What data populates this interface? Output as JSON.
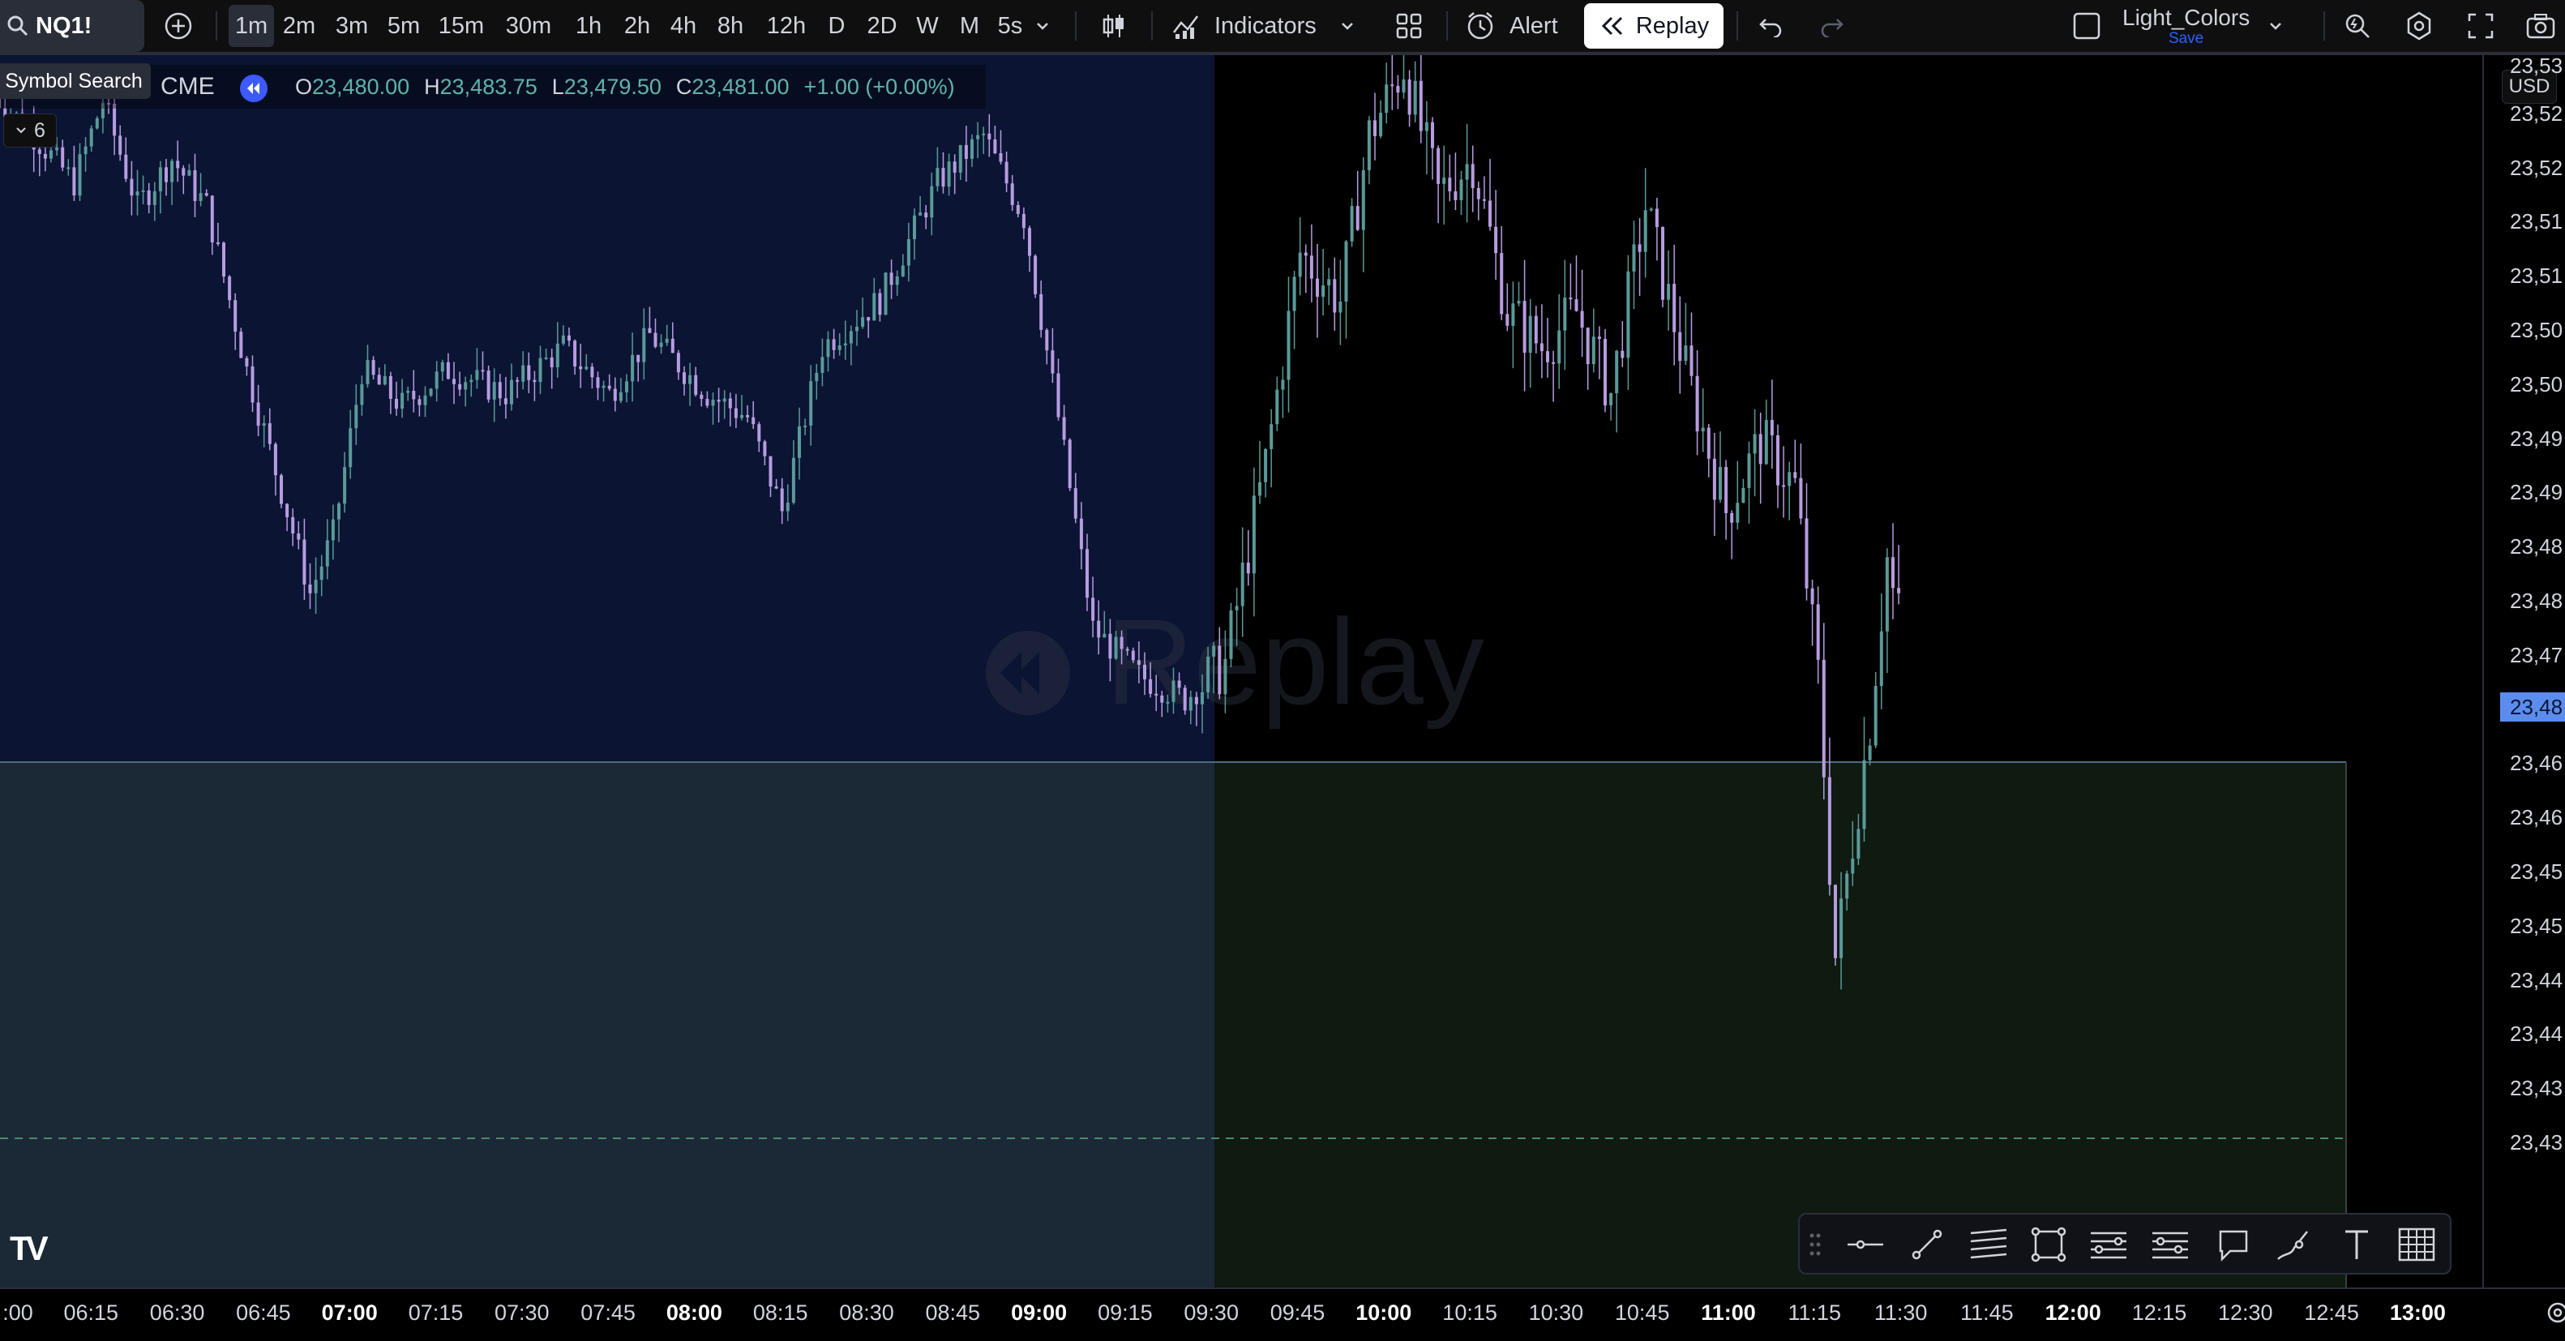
{
  "toolbar": {
    "symbol": "NQ1!",
    "timeframes": [
      "1m",
      "2m",
      "3m",
      "5m",
      "15m",
      "30m",
      "1h",
      "2h",
      "4h",
      "8h",
      "12h",
      "D",
      "2D",
      "W",
      "M",
      "5s"
    ],
    "active_timeframe": "1m",
    "indicators_label": "Indicators",
    "alert_label": "Alert",
    "replay_label": "Replay",
    "layout_name": "Light_Colors",
    "layout_save_label": "Save",
    "icons": [
      "search-icon",
      "add-symbol-icon",
      "chevron-down-icon",
      "candle-style-icon",
      "indicators-icon",
      "templates-grid-icon",
      "alert-clock-icon",
      "replay-rewind-icon",
      "undo-icon",
      "redo-icon",
      "layout-checkbox-icon",
      "quick-search-icon",
      "settings-gear-icon",
      "fullscreen-icon",
      "snapshot-camera-icon"
    ]
  },
  "tooltip": {
    "text": "Symbol Search"
  },
  "legend": {
    "exchange": "CME",
    "open_label": "O",
    "open": "23,480.00",
    "high_label": "H",
    "high": "23,483.75",
    "low_label": "L",
    "low": "23,479.50",
    "close_label": "C",
    "close": "23,481.00",
    "change": "+1.00 (+0.00%)",
    "collapse_count": "6"
  },
  "watermark": {
    "text": "Replay"
  },
  "price_axis": {
    "currency": "USD",
    "labels": [
      "23,53",
      "23,52",
      "23,52",
      "23,51",
      "23,51",
      "23,50",
      "23,50",
      "23,49",
      "23,49",
      "23,48",
      "23,48",
      "23,47",
      "23,47",
      "23,46",
      "23,46",
      "23,45",
      "23,45",
      "23,44",
      "23,44",
      "23,43",
      "23,43"
    ],
    "current_price": "23,48"
  },
  "time_axis": {
    "labels": [
      {
        "t": ":00",
        "bold": false
      },
      {
        "t": "06:15",
        "bold": false
      },
      {
        "t": "06:30",
        "bold": false
      },
      {
        "t": "06:45",
        "bold": false
      },
      {
        "t": "07:00",
        "bold": true
      },
      {
        "t": "07:15",
        "bold": false
      },
      {
        "t": "07:30",
        "bold": false
      },
      {
        "t": "07:45",
        "bold": false
      },
      {
        "t": "08:00",
        "bold": true
      },
      {
        "t": "08:15",
        "bold": false
      },
      {
        "t": "08:30",
        "bold": false
      },
      {
        "t": "08:45",
        "bold": false
      },
      {
        "t": "09:00",
        "bold": true
      },
      {
        "t": "09:15",
        "bold": false
      },
      {
        "t": "09:30",
        "bold": false
      },
      {
        "t": "09:45",
        "bold": false
      },
      {
        "t": "10:00",
        "bold": true
      },
      {
        "t": "10:15",
        "bold": false
      },
      {
        "t": "10:30",
        "bold": false
      },
      {
        "t": "10:45",
        "bold": false
      },
      {
        "t": "11:00",
        "bold": true
      },
      {
        "t": "11:15",
        "bold": false
      },
      {
        "t": "11:30",
        "bold": false
      },
      {
        "t": "11:45",
        "bold": false
      },
      {
        "t": "12:00",
        "bold": true
      },
      {
        "t": "12:15",
        "bold": false
      },
      {
        "t": "12:30",
        "bold": false
      },
      {
        "t": "12:45",
        "bold": false
      },
      {
        "t": "13:00",
        "bold": true
      }
    ]
  },
  "drawing_tools": [
    "drag-handle-icon",
    "horizontal-ray-icon",
    "trend-line-icon",
    "parallel-channel-icon",
    "rectangle-icon",
    "fib-retracement-icon",
    "fib-levels-icon",
    "callout-icon",
    "brush-icon",
    "text-tool-icon",
    "grid-table-icon"
  ],
  "brand": {
    "logo_text": "TV"
  },
  "colors": {
    "background": "#000000",
    "premarket_bg": "#0b1433",
    "range_box_left": "#1b2836",
    "range_box_right": "#0f1a10",
    "candle_up": "#5a9a98",
    "candle_down": "#b79ce0",
    "replay_button_bg": "#ffffff",
    "legend_values": "#5fb3a9",
    "price_marker": "#5b8def"
  },
  "chart_data": {
    "type": "candlestick",
    "symbol": "NQ1!",
    "interval": "1m",
    "x_range": [
      "06:00",
      "13:00"
    ],
    "y_range": [
      23430,
      23535
    ],
    "last_bar": {
      "open": 23480.0,
      "high": 23483.75,
      "low": 23479.5,
      "close": 23481.0
    },
    "session_start": "09:30",
    "range_box": {
      "top": 23475,
      "bottom": 23430,
      "x_end": "12:45"
    },
    "dashed_level": 23443,
    "replay_cursor": "11:31",
    "anchors": [
      [
        "06:00",
        23524
      ],
      [
        "06:08",
        23520
      ],
      [
        "06:15",
        23516
      ],
      [
        "06:20",
        23523
      ],
      [
        "06:26",
        23514
      ],
      [
        "06:32",
        23518
      ],
      [
        "06:38",
        23514
      ],
      [
        "06:45",
        23500
      ],
      [
        "06:52",
        23488
      ],
      [
        "06:56",
        23481
      ],
      [
        "07:00",
        23486
      ],
      [
        "07:05",
        23500
      ],
      [
        "07:12",
        23497
      ],
      [
        "07:20",
        23500
      ],
      [
        "07:30",
        23498
      ],
      [
        "07:40",
        23502
      ],
      [
        "07:48",
        23498
      ],
      [
        "07:55",
        23503
      ],
      [
        "08:05",
        23498
      ],
      [
        "08:12",
        23496
      ],
      [
        "08:18",
        23488
      ],
      [
        "08:25",
        23502
      ],
      [
        "08:35",
        23506
      ],
      [
        "08:45",
        23516
      ],
      [
        "08:53",
        23520
      ],
      [
        "09:00",
        23513
      ],
      [
        "09:06",
        23496
      ],
      [
        "09:12",
        23478
      ],
      [
        "09:20",
        23474
      ],
      [
        "09:28",
        23472
      ],
      [
        "09:35",
        23475
      ],
      [
        "09:42",
        23492
      ],
      [
        "09:48",
        23510
      ],
      [
        "09:55",
        23506
      ],
      [
        "10:00",
        23520
      ],
      [
        "10:06",
        23526
      ],
      [
        "10:12",
        23515
      ],
      [
        "10:18",
        23518
      ],
      [
        "10:24",
        23505
      ],
      [
        "10:30",
        23502
      ],
      [
        "10:36",
        23505
      ],
      [
        "10:42",
        23498
      ],
      [
        "10:48",
        23514
      ],
      [
        "10:55",
        23500
      ],
      [
        "11:02",
        23488
      ],
      [
        "11:08",
        23494
      ],
      [
        "11:14",
        23490
      ],
      [
        "11:18",
        23474
      ],
      [
        "11:21",
        23450
      ],
      [
        "11:24",
        23460
      ],
      [
        "11:27",
        23470
      ],
      [
        "11:30",
        23484
      ],
      [
        "11:31",
        23481
      ]
    ]
  }
}
